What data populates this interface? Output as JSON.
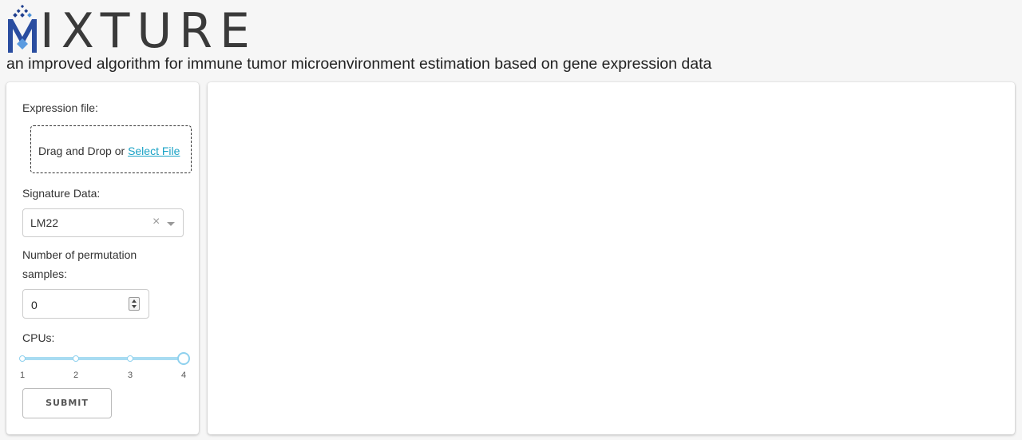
{
  "header": {
    "logo_text": "MIXTURE",
    "logo_visible_text": "IXTURE",
    "tagline": "an improved algorithm for immune tumor microenvironment estimation based on gene expression data"
  },
  "sidebar": {
    "expression_label": "Expression file:",
    "dropzone_text": "Drag and Drop or ",
    "dropzone_link": "Select File",
    "signature_label": "Signature Data:",
    "signature_value": "LM22",
    "signature_clear": "×",
    "permutation_label": "Number of permutation samples:",
    "permutation_value": "0",
    "cpus_label": "CPUs:",
    "cpus_slider": {
      "min": 1,
      "max": 4,
      "value": 4,
      "ticks": [
        "1",
        "2",
        "3",
        "4"
      ]
    },
    "submit_label": "SUBMIT"
  },
  "colors": {
    "accent": "#1ba3c6",
    "slider": "#a8dcf2",
    "logo_blue": "#1f3f8f",
    "logo_light": "#4a90d9"
  }
}
